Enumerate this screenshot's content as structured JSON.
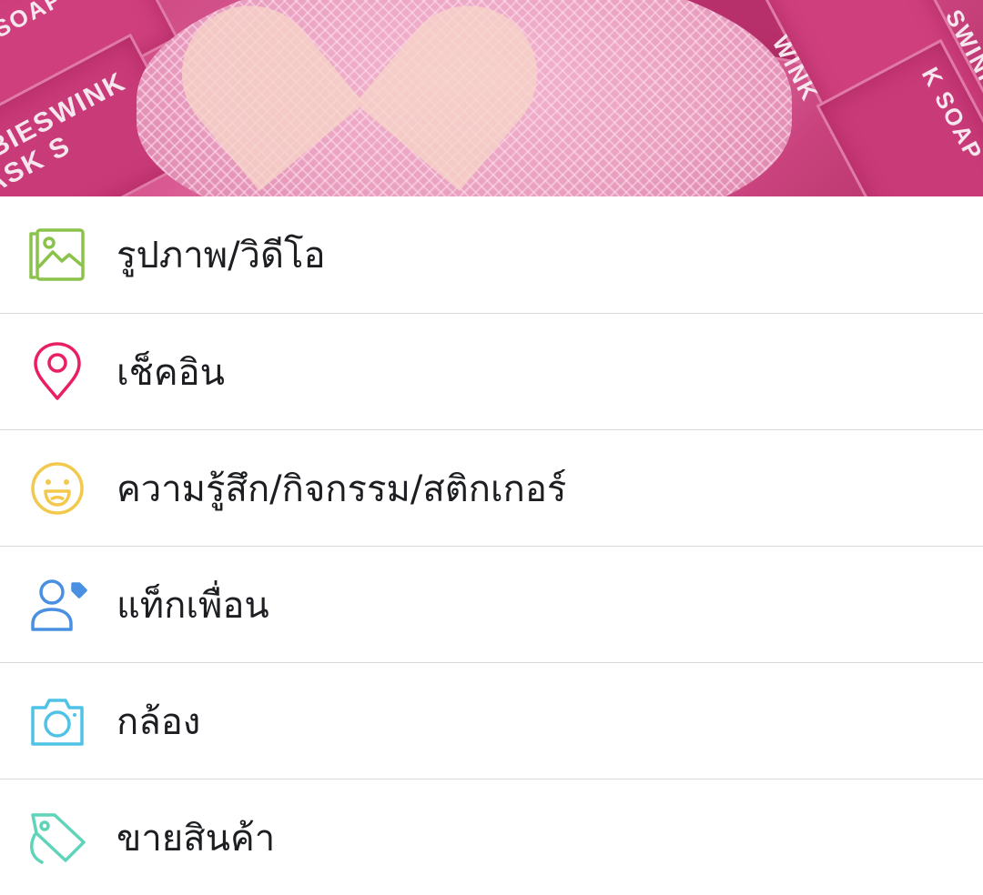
{
  "banner": {
    "box_text_1": "BIESWINK",
    "box_text_2": "ASK S",
    "box_text_3": "WINK",
    "box_text_4": "SOAP",
    "box_text_5": "SWINK",
    "box_text_6": "K SOAP"
  },
  "menu": {
    "items": [
      {
        "label": "รูปภาพ/วิดีโอ",
        "icon": "photo-video-icon",
        "color": "#8bc34a"
      },
      {
        "label": "เช็คอิน",
        "icon": "location-pin-icon",
        "color": "#e91e63"
      },
      {
        "label": "ความรู้สึก/กิจกรรม/สติกเกอร์",
        "icon": "smiley-face-icon",
        "color": "#f2c94c"
      },
      {
        "label": "แท็กเพื่อน",
        "icon": "tag-person-icon",
        "color": "#4a90e2"
      },
      {
        "label": "กล้อง",
        "icon": "camera-icon",
        "color": "#4fc3e6"
      },
      {
        "label": "ขายสินค้า",
        "icon": "price-tag-icon",
        "color": "#5fd4b8"
      }
    ]
  }
}
